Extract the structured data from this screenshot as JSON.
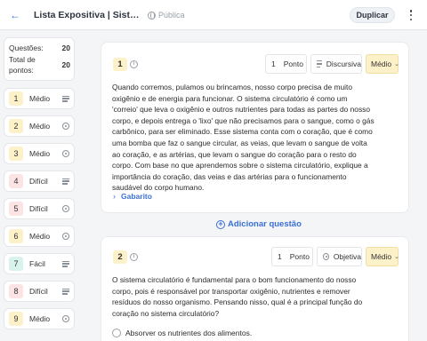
{
  "header": {
    "title": "Lista Expositiva | Sistema Circulatório",
    "visibility": "Pública",
    "duplicate_label": "Duplicar"
  },
  "sidebar": {
    "questions_label": "Questões:",
    "questions_value": "20",
    "points_label_1": "Total de",
    "points_label_2": "pontos:",
    "points_value": "20",
    "items": [
      {
        "num": "1",
        "difficulty": "Médio",
        "color": "yellow",
        "type_icon": "lines-icon"
      },
      {
        "num": "2",
        "difficulty": "Médio",
        "color": "yellow",
        "type_icon": "radio-icon"
      },
      {
        "num": "3",
        "difficulty": "Médio",
        "color": "yellow",
        "type_icon": "radio-icon"
      },
      {
        "num": "4",
        "difficulty": "Difícil",
        "color": "red",
        "type_icon": "lines-icon"
      },
      {
        "num": "5",
        "difficulty": "Difícil",
        "color": "red",
        "type_icon": "radio-icon"
      },
      {
        "num": "6",
        "difficulty": "Médio",
        "color": "yellow",
        "type_icon": "radio-icon"
      },
      {
        "num": "7",
        "difficulty": "Fácil",
        "color": "green",
        "type_icon": "lines-icon"
      },
      {
        "num": "8",
        "difficulty": "Difícil",
        "color": "red",
        "type_icon": "lines-icon"
      },
      {
        "num": "9",
        "difficulty": "Médio",
        "color": "yellow",
        "type_icon": "radio-icon"
      }
    ]
  },
  "questions": [
    {
      "num": "1",
      "points": "1",
      "points_unit": "Ponto",
      "type": "Discursiva",
      "difficulty": "Médio",
      "text": "Quando corremos, pulamos ou brincamos, nosso corpo precisa de muito oxigênio e de energia para funcionar. O sistema circulatório é como um 'correio' que leva o oxigênio e outros nutrientes para todas as partes do nosso corpo, e depois entrega o 'lixo' que não precisamos para o sangue, como o gás carbônico, para ser eliminado. Esse sistema conta com o coração, que é como uma bomba que faz o sangue circular, as veias, que levam o sangue de volta ao coração, e as artérias, que levam o sangue do coração para o resto do corpo. Com base no que aprendemos sobre o sistema circulatório, explique a importância do coração, das veias e das artérias para o funcionamento saudável do corpo humano.",
      "answer_label": "Gabarito"
    },
    {
      "num": "2",
      "points": "1",
      "points_unit": "Ponto",
      "type": "Objetiva",
      "difficulty": "Médio",
      "text": "O sistema circulatório é fundamental para o bom funcionamento do nosso corpo, pois é responsável por transportar oxigênio, nutrientes e remover resíduos do nosso organismo. Pensando nisso, qual é a principal função do coração no sistema circulatório?",
      "options": [
        "Absorver os nutrientes dos alimentos."
      ]
    }
  ],
  "add_question_label": "Adicionar questão",
  "colors": {
    "accent": "#3b6fd8",
    "medium": "#fdf1c9",
    "easy": "#d8f2ec",
    "hard": "#fde4e4"
  }
}
